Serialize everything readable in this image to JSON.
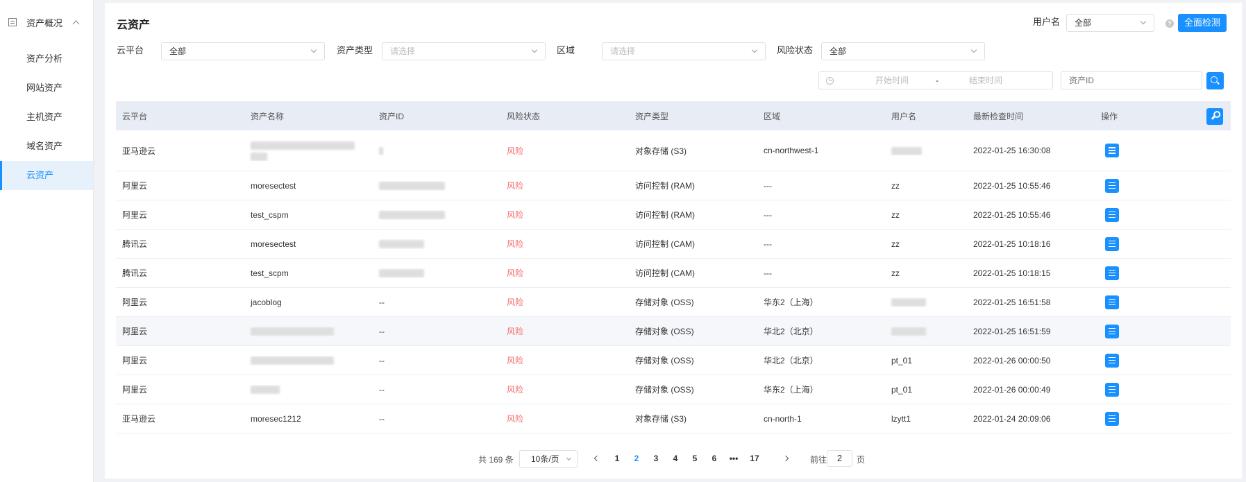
{
  "sidebar": {
    "group_label": "资产概况",
    "items": [
      {
        "label": "资产分析"
      },
      {
        "label": "网站资产"
      },
      {
        "label": "主机资产"
      },
      {
        "label": "域名资产"
      },
      {
        "label": "云资产"
      }
    ],
    "active_index": 4
  },
  "header": {
    "title": "云资产",
    "username_label": "用户名",
    "username_value": "全部",
    "full_check_label": "全面检测",
    "help_glyph": "?"
  },
  "filters": {
    "platform_label": "云平台",
    "platform_value": "全部",
    "asset_type_label": "资产类型",
    "asset_type_placeholder": "请选择",
    "region_label": "区域",
    "region_placeholder": "请选择",
    "risk_label": "风险状态",
    "risk_value": "全部",
    "start_placeholder": "开始时间",
    "date_separator": "-",
    "end_placeholder": "结束时间",
    "asset_id_placeholder": "资产ID"
  },
  "table": {
    "columns": [
      "云平台",
      "资产名称",
      "资产ID",
      "风险状态",
      "资产类型",
      "区域",
      "用户名",
      "最新检查时间",
      "操作"
    ],
    "rows": [
      {
        "platform": "亚马逊云",
        "name": "",
        "id": "",
        "risk": "风险",
        "type": "对象存储 (S3)",
        "region": "cn-northwest-1",
        "user": "",
        "time": "2022-01-25 16:30:08"
      },
      {
        "platform": "阿里云",
        "name": "moresectest",
        "id": "",
        "risk": "风险",
        "type": "访问控制 (RAM)",
        "region": "---",
        "user": "zz",
        "time": "2022-01-25 10:55:46"
      },
      {
        "platform": "阿里云",
        "name": "test_cspm",
        "id": "",
        "risk": "风险",
        "type": "访问控制 (RAM)",
        "region": "---",
        "user": "zz",
        "time": "2022-01-25 10:55:46"
      },
      {
        "platform": "腾讯云",
        "name": "moresectest",
        "id": "",
        "risk": "风险",
        "type": "访问控制 (CAM)",
        "region": "---",
        "user": "zz",
        "time": "2022-01-25 10:18:16"
      },
      {
        "platform": "腾讯云",
        "name": "test_scpm",
        "id": "",
        "risk": "风险",
        "type": "访问控制 (CAM)",
        "region": "---",
        "user": "zz",
        "time": "2022-01-25 10:18:15"
      },
      {
        "platform": "阿里云",
        "name": "jacoblog",
        "id": "--",
        "risk": "风险",
        "type": "存储对象 (OSS)",
        "region": "华东2（上海）",
        "user": "",
        "time": "2022-01-25 16:51:58"
      },
      {
        "platform": "阿里云",
        "name": "",
        "id": "--",
        "risk": "风险",
        "type": "存储对象 (OSS)",
        "region": "华北2（北京）",
        "user": "",
        "time": "2022-01-25 16:51:59"
      },
      {
        "platform": "阿里云",
        "name": "",
        "id": "--",
        "risk": "风险",
        "type": "存储对象 (OSS)",
        "region": "华北2（北京）",
        "user": "pt_01",
        "time": "2022-01-26 00:00:50"
      },
      {
        "platform": "阿里云",
        "name": "",
        "id": "--",
        "risk": "风险",
        "type": "存储对象 (OSS)",
        "region": "华东2（上海）",
        "user": "pt_01",
        "time": "2022-01-26 00:00:49"
      },
      {
        "platform": "亚马逊云",
        "name": "moresec1212",
        "id": "--",
        "risk": "风险",
        "type": "对象存储 (S3)",
        "region": "cn-north-1",
        "user": "lzytt1",
        "time": "2022-01-24 20:09:06"
      }
    ]
  },
  "pagination": {
    "total": "共 169 条",
    "page_size": "10条/页",
    "pages": [
      "1",
      "2",
      "3",
      "4",
      "5",
      "6",
      "•••",
      "17"
    ],
    "current_page": "2",
    "goto_label": "前往",
    "goto_value": "2",
    "goto_unit": "页"
  },
  "colors": {
    "primary": "#1890ff",
    "risk": "#f56c6c",
    "header_bg": "#e8edf5",
    "active_bg": "#e6f1fc"
  },
  "icons": [
    "list-icon",
    "chevron-up-icon",
    "help-icon",
    "clock-icon",
    "search-icon",
    "wrench-icon",
    "detail-list-icon",
    "chevron-left-icon",
    "chevron-right-icon",
    "chevron-down-icon"
  ]
}
